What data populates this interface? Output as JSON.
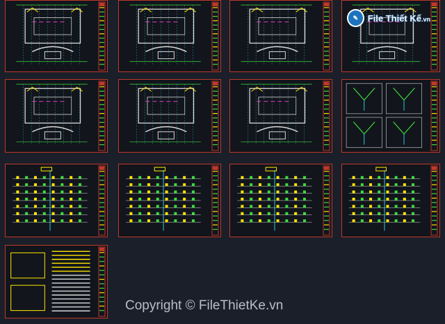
{
  "watermark": {
    "brand": "File Thiết Kế",
    "tld": ".vn",
    "copyright": "Copyright © FileThietKe.vn"
  },
  "sheets": [
    {
      "id": "floor-plan-1",
      "kind": "plan"
    },
    {
      "id": "floor-plan-2",
      "kind": "plan"
    },
    {
      "id": "floor-plan-3",
      "kind": "plan"
    },
    {
      "id": "floor-plan-4",
      "kind": "plan"
    },
    {
      "id": "floor-plan-5",
      "kind": "plan"
    },
    {
      "id": "floor-plan-6",
      "kind": "plan"
    },
    {
      "id": "floor-plan-7",
      "kind": "plan"
    },
    {
      "id": "detail-sheet",
      "kind": "details"
    },
    {
      "id": "riser-diagram-1",
      "kind": "riser"
    },
    {
      "id": "riser-diagram-2",
      "kind": "riser"
    },
    {
      "id": "riser-diagram-3",
      "kind": "riser"
    },
    {
      "id": "riser-diagram-4",
      "kind": "riser"
    },
    {
      "id": "schedule-sheet",
      "kind": "schedule"
    }
  ],
  "colors": {
    "background": "#1b1f29",
    "sheet": "#12151c",
    "frame": "#c0392b",
    "line_green": "#3ddc3d",
    "line_yellow": "#ffe600",
    "line_white": "#d8d8d8",
    "line_cyan": "#29c7e6",
    "line_magenta": "#e040c0"
  }
}
